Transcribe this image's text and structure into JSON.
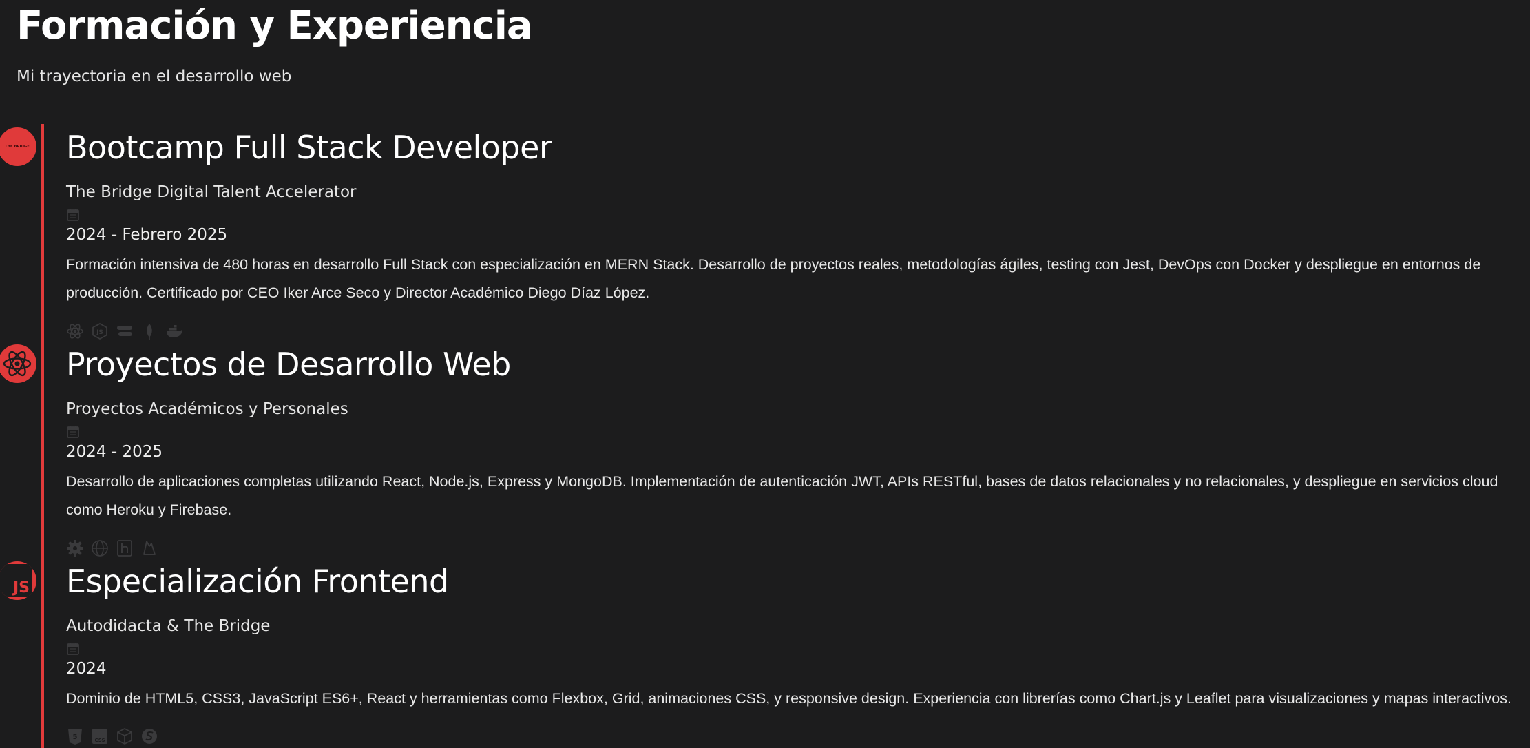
{
  "header": {
    "title": "Formación y Experiencia",
    "subtitle": "Mi trayectoria en el desarrollo web"
  },
  "colors": {
    "background": "#1c1c1d",
    "accent": "#e03a3a",
    "text": "#ffffff",
    "icon_muted": "#3a3a3c"
  },
  "timeline": {
    "entries": [
      {
        "title": "Bootcamp Full Stack Developer",
        "organization": "The Bridge Digital Talent Accelerator",
        "date": "2024 - Febrero 2025",
        "description": "Formación intensiva de 480 horas en desarrollo Full Stack con especialización en MERN Stack. Desarrollo de proyectos reales, metodologías ágiles, testing con Jest, DevOps con Docker y despliegue en entornos de producción. Certificado por CEO Iker Arce Seco y Director Académico Diego Díaz López.",
        "marker": "the-bridge-logo",
        "marker_text": "THE BRIDGE",
        "tech_icons": [
          "react-icon",
          "nodejs-icon",
          "express-icon",
          "mongodb-icon",
          "docker-icon"
        ]
      },
      {
        "title": "Proyectos de Desarrollo Web",
        "organization": "Proyectos Académicos y Personales",
        "date": "2024 - 2025",
        "description": "Desarrollo de aplicaciones completas utilizando React, Node.js, Express y MongoDB. Implementación de autenticación JWT, APIs RESTful, bases de datos relacionales y no relacionales, y despliegue en servicios cloud como Heroku y Firebase.",
        "marker": "react-icon",
        "tech_icons": [
          "gear-icon",
          "globe-icon",
          "heroku-icon",
          "firebase-icon"
        ]
      },
      {
        "title": "Especialización Frontend",
        "organization": "Autodidacta & The Bridge",
        "date": "2024",
        "description": "Dominio de HTML5, CSS3, JavaScript ES6+, React y herramientas como Flexbox, Grid, animaciones CSS, y responsive design. Experiencia con librerías como Chart.js y Leaflet para visualizaciones y mapas interactivos.",
        "marker": "javascript-icon",
        "marker_text": "JS",
        "tech_icons": [
          "html5-icon",
          "css3-icon",
          "box-icon",
          "sass-icon"
        ]
      }
    ]
  }
}
